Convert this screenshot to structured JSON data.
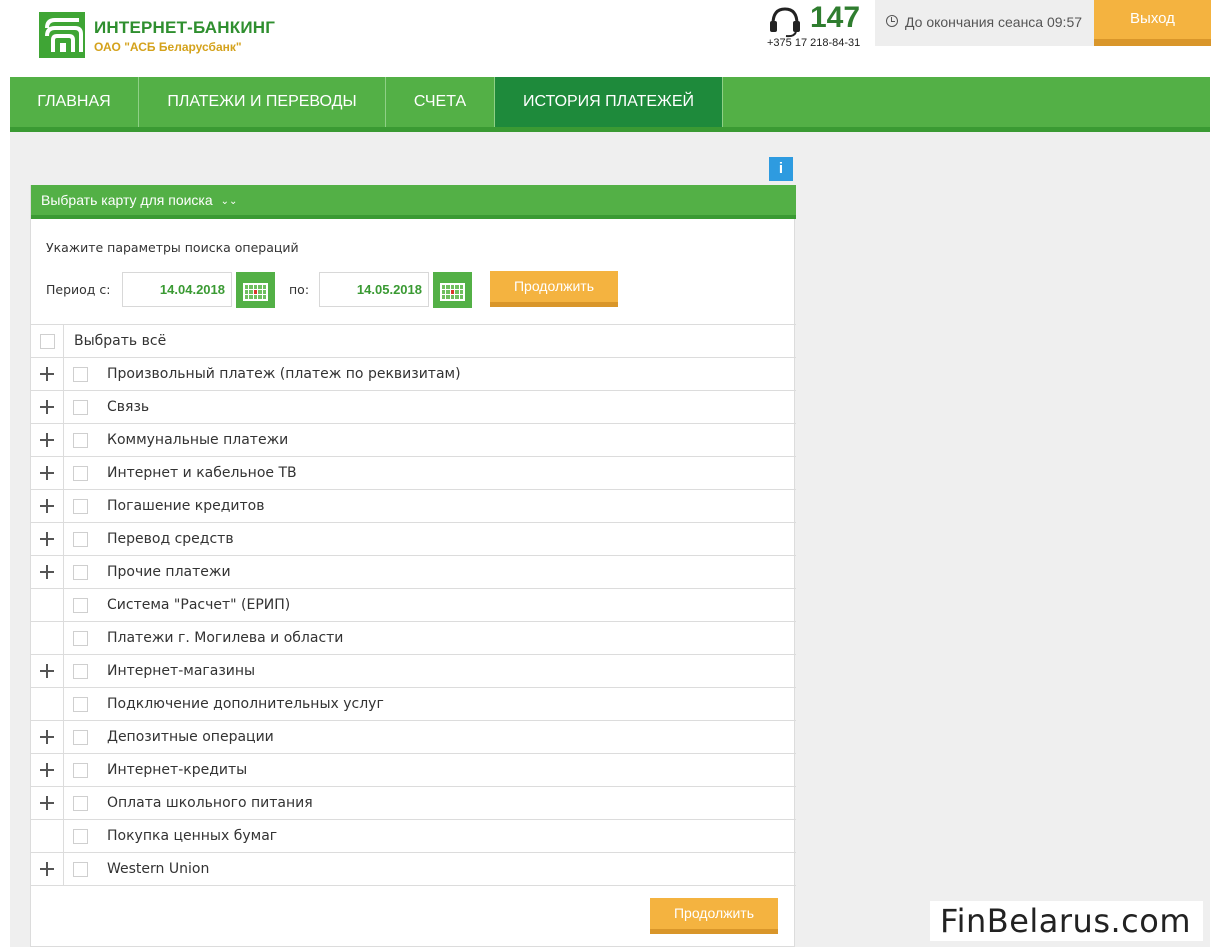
{
  "header": {
    "brand_title": "ИНТЕРНЕТ-БАНКИНГ",
    "brand_subtitle": "ОАО \"АСБ Беларусбанк\"",
    "phone_short": "147",
    "phone_full": "+375 17 218-84-31",
    "session_text": "До окончания сеанса 09:57",
    "logout_label": "Выход"
  },
  "nav": {
    "items": [
      {
        "label": "ГЛАВНАЯ"
      },
      {
        "label": "ПЛАТЕЖИ И ПЕРЕВОДЫ"
      },
      {
        "label": "СЧЕТА"
      },
      {
        "label": "ИСТОРИЯ ПЛАТЕЖЕЙ"
      }
    ],
    "active": "ИСТОРИЯ ПЛАТЕЖЕЙ"
  },
  "info_icon": "i",
  "panel": {
    "header_label": "Выбрать карту для поиска",
    "hint": "Укажите параметры поиска операций",
    "period_label": "Период с:",
    "to_label": "по:",
    "date_from": "14.04.2018",
    "date_to": "14.05.2018",
    "continue_label": "Продолжить",
    "select_all": "Выбрать всё",
    "categories": [
      {
        "label": "Произвольный платеж (платеж по реквизитам)",
        "expandable": true
      },
      {
        "label": "Связь",
        "expandable": true
      },
      {
        "label": "Коммунальные платежи",
        "expandable": true
      },
      {
        "label": "Интернет и кабельное ТВ",
        "expandable": true
      },
      {
        "label": "Погашение кредитов",
        "expandable": true
      },
      {
        "label": "Перевод средств",
        "expandable": true
      },
      {
        "label": "Прочие платежи",
        "expandable": true
      },
      {
        "label": "Система \"Расчет\" (ЕРИП)",
        "expandable": false
      },
      {
        "label": "Платежи г. Могилева и области",
        "expandable": false
      },
      {
        "label": "Интернет-магазины",
        "expandable": true
      },
      {
        "label": "Подключение дополнительных услуг",
        "expandable": false
      },
      {
        "label": "Депозитные операции",
        "expandable": true
      },
      {
        "label": "Интернет-кредиты",
        "expandable": true
      },
      {
        "label": "Оплата школьного питания",
        "expandable": true
      },
      {
        "label": "Покупка ценных бумаг",
        "expandable": false
      },
      {
        "label": "Western Union",
        "expandable": true
      }
    ],
    "bottom_continue_label": "Продолжить"
  },
  "watermark": "FinBelarus.com",
  "colors": {
    "nav_green": "#53b046",
    "nav_active": "#1e8a3b",
    "button_orange": "#f4b340",
    "date_text_green": "#3a9a33"
  }
}
